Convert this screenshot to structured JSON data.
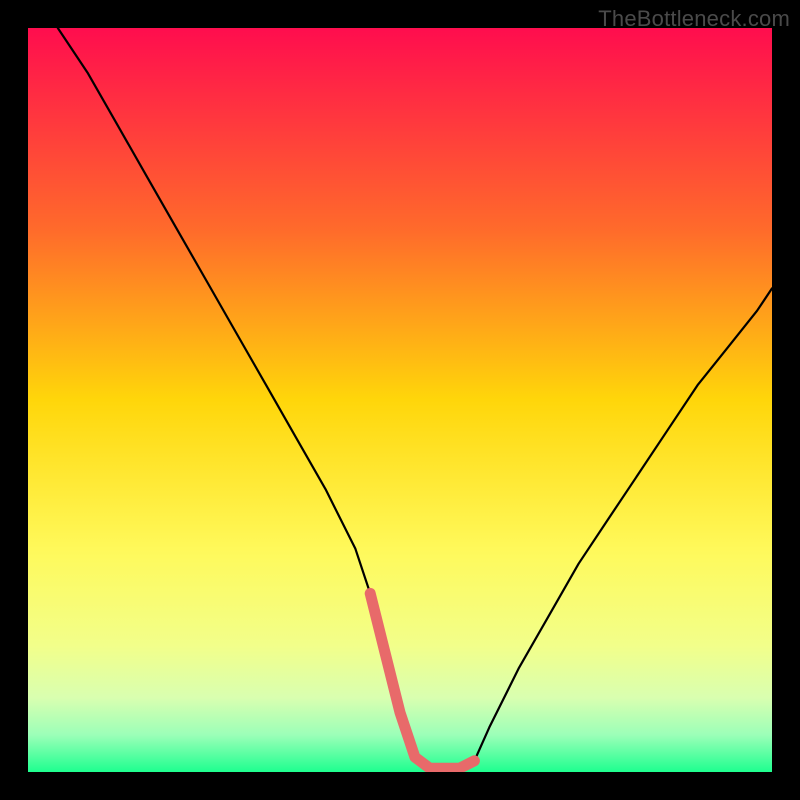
{
  "watermark": "TheBottleneck.com",
  "chart_data": {
    "type": "line",
    "title": "",
    "xlabel": "",
    "ylabel": "",
    "xlim": [
      0,
      100
    ],
    "ylim": [
      0,
      100
    ],
    "x": [
      4,
      8,
      12,
      16,
      20,
      24,
      28,
      32,
      36,
      40,
      44,
      46,
      48,
      50,
      52,
      54,
      56,
      58,
      60,
      62,
      66,
      70,
      74,
      78,
      82,
      86,
      90,
      94,
      98,
      100
    ],
    "series": [
      {
        "name": "curve",
        "values": [
          100,
          94,
          87,
          80,
          73,
          66,
          59,
          52,
          45,
          38,
          30,
          24,
          16,
          8,
          2,
          0.5,
          0.5,
          0.5,
          1.5,
          6,
          14,
          21,
          28,
          34,
          40,
          46,
          52,
          57,
          62,
          65
        ]
      }
    ],
    "highlight_range_x": [
      46,
      61
    ],
    "gradient_stops": [
      {
        "offset": 0.0,
        "color": "#ff0d4e"
      },
      {
        "offset": 0.27,
        "color": "#ff6a2b"
      },
      {
        "offset": 0.5,
        "color": "#ffd60a"
      },
      {
        "offset": 0.7,
        "color": "#fff95a"
      },
      {
        "offset": 0.83,
        "color": "#f2ff8a"
      },
      {
        "offset": 0.9,
        "color": "#d9ffb0"
      },
      {
        "offset": 0.95,
        "color": "#9cffb8"
      },
      {
        "offset": 1.0,
        "color": "#1eff8f"
      }
    ]
  }
}
